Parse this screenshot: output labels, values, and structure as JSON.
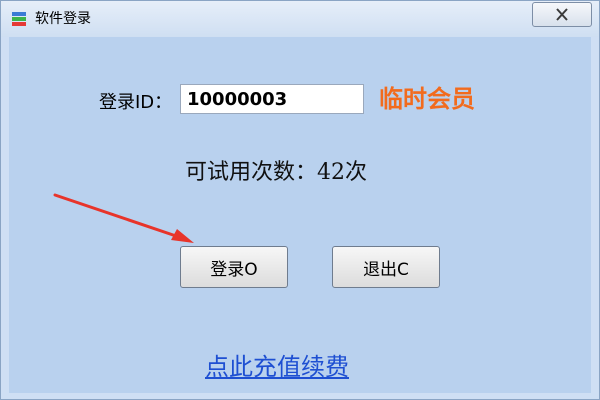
{
  "window": {
    "title": "软件登录",
    "icon": "app-logo-icon",
    "close_icon": "close-icon"
  },
  "form": {
    "id_label": "登录ID：",
    "id_value": "10000003",
    "member_status": "临时会员",
    "trial_text": "可试用次数：42次"
  },
  "buttons": {
    "login": "登录O",
    "exit": "退出C"
  },
  "link": {
    "recharge": "点此充值续费"
  },
  "colors": {
    "accent_orange": "#f26b1d",
    "link_blue": "#1e4fd2",
    "panel_bg": "#b9d1ee",
    "annotation_red": "#e8342a"
  }
}
